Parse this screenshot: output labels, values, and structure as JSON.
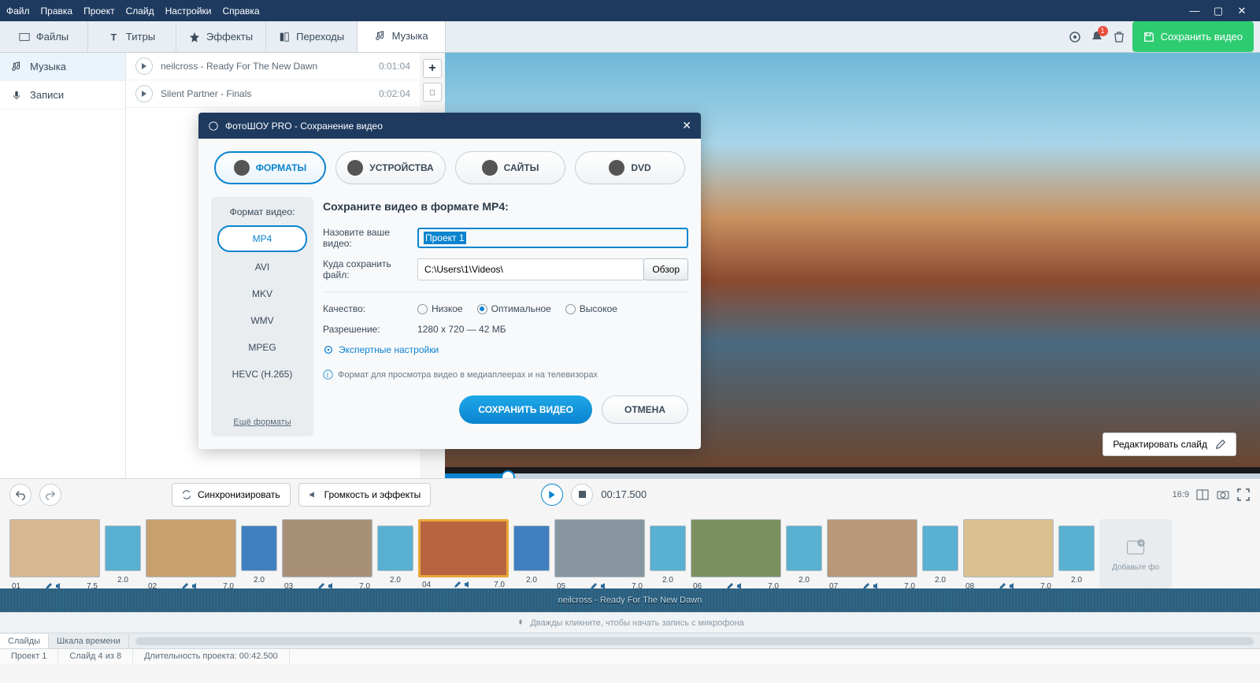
{
  "menubar": [
    "Файл",
    "Правка",
    "Проект",
    "Слайд",
    "Настройки",
    "Справка"
  ],
  "tabs": [
    {
      "label": "Файлы"
    },
    {
      "label": "Титры"
    },
    {
      "label": "Эффекты"
    },
    {
      "label": "Переходы"
    },
    {
      "label": "Музыка"
    }
  ],
  "save_button": "Сохранить видео",
  "notif_count": "1",
  "left_items": [
    {
      "label": "Музыка"
    },
    {
      "label": "Записи"
    }
  ],
  "tracks": [
    {
      "name": "neilcross - Ready For The New Dawn",
      "dur": "0:01:04"
    },
    {
      "name": "Silent Partner - Finals",
      "dur": "0:02:04"
    }
  ],
  "preview": {
    "edit_label": "Редактировать слайд"
  },
  "dialog": {
    "title": "ФотоШОУ PRO - Сохранение видео",
    "tabs": [
      "ФОРМАТЫ",
      "УСТРОЙСТВА",
      "САЙТЫ",
      "DVD"
    ],
    "fmt_heading": "Формат видео:",
    "formats": [
      "MP4",
      "AVI",
      "MKV",
      "WMV",
      "MPEG",
      "HEVC (H.265)"
    ],
    "more_label": "Ещё форматы",
    "heading": "Сохраните видео в формате MP4:",
    "name_label": "Назовите ваше видео:",
    "name_value": "Проект 1",
    "path_label": "Куда сохранить файл:",
    "path_value": "C:\\Users\\1\\Videos\\",
    "browse": "Обзор",
    "quality_label": "Качество:",
    "quality_opts": [
      "Низкое",
      "Оптимальное",
      "Высокое"
    ],
    "res_label": "Разрешение:",
    "res_value": "1280 x 720   —   42 МБ",
    "expert": "Экспертные настройки",
    "hint": "Формат для просмотра видео в медиаплеерах и на телевизорах",
    "btn_save": "СОХРАНИТЬ ВИДЕО",
    "btn_cancel": "ОТМЕНА"
  },
  "controls": {
    "sync": "Синхронизировать",
    "volume": "Громкость и эффекты",
    "time": "00:17.500",
    "aspect": "16:9"
  },
  "slides": [
    {
      "n": "01",
      "d": "7.5",
      "t": "2.0"
    },
    {
      "n": "02",
      "d": "7.0",
      "t": "2.0"
    },
    {
      "n": "03",
      "d": "7.0",
      "t": "2.0"
    },
    {
      "n": "04",
      "d": "7.0",
      "t": "2.0"
    },
    {
      "n": "05",
      "d": "7.0",
      "t": "2.0"
    },
    {
      "n": "06",
      "d": "7.0",
      "t": "2.0"
    },
    {
      "n": "07",
      "d": "7.0",
      "t": "2.0"
    },
    {
      "n": "08",
      "d": "7.0",
      "t": "2.0"
    }
  ],
  "add_slide": "Добавьте фо",
  "audio_label": "neilcross - Ready For The New Dawn",
  "rec_hint": "Дважды кликните, чтобы начать запись с микрофона",
  "footer_tabs": [
    "Слайды",
    "Шкала времени"
  ],
  "status": {
    "project": "Проект 1",
    "slide": "Слайд 4 из 8",
    "duration": "Длительность проекта: 00:42.500"
  }
}
